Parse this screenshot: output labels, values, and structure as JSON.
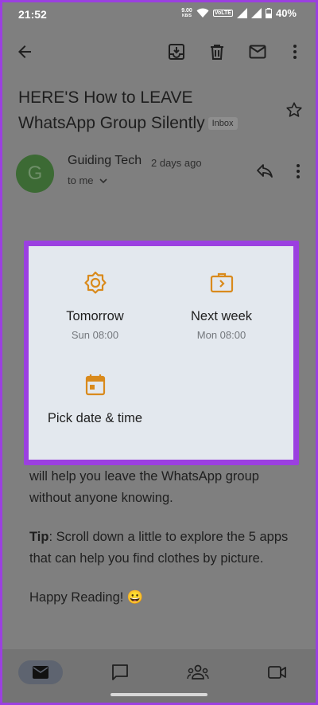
{
  "status_bar": {
    "time": "21:52",
    "net_speed": "9.00",
    "net_unit": "KB/S",
    "volte": "VoLTE",
    "battery": "40%"
  },
  "email": {
    "subject": "HERE'S How to LEAVE WhatsApp Group Silently",
    "label": "Inbox",
    "sender": {
      "initial": "G",
      "name": "Guiding Tech",
      "time": "2 days ago",
      "recipient": "to me"
    },
    "body": {
      "line1": "will help you leave the WhatsApp group without anyone knowing.",
      "tip_label": "Tip",
      "tip_text": ": Scroll down a little to explore the 5 apps that can help you find clothes by picture.",
      "closing": "Happy Reading! 😀"
    }
  },
  "snooze_dialog": {
    "options": [
      {
        "label": "Tomorrow",
        "sub": "Sun 08:00",
        "icon": "sun-icon"
      },
      {
        "label": "Next week",
        "sub": "Mon 08:00",
        "icon": "briefcase-icon"
      },
      {
        "label": "Pick date & time",
        "icon": "calendar-icon"
      }
    ],
    "accent": "#d98a1c"
  },
  "bottom_nav": {
    "items": [
      "mail-icon",
      "chat-icon",
      "meet-people-icon",
      "video-icon"
    ]
  },
  "colors": {
    "highlight_border": "#9b40e0",
    "scrim": "#7f7f7f",
    "dialog_bg": "#e3e8ee"
  }
}
